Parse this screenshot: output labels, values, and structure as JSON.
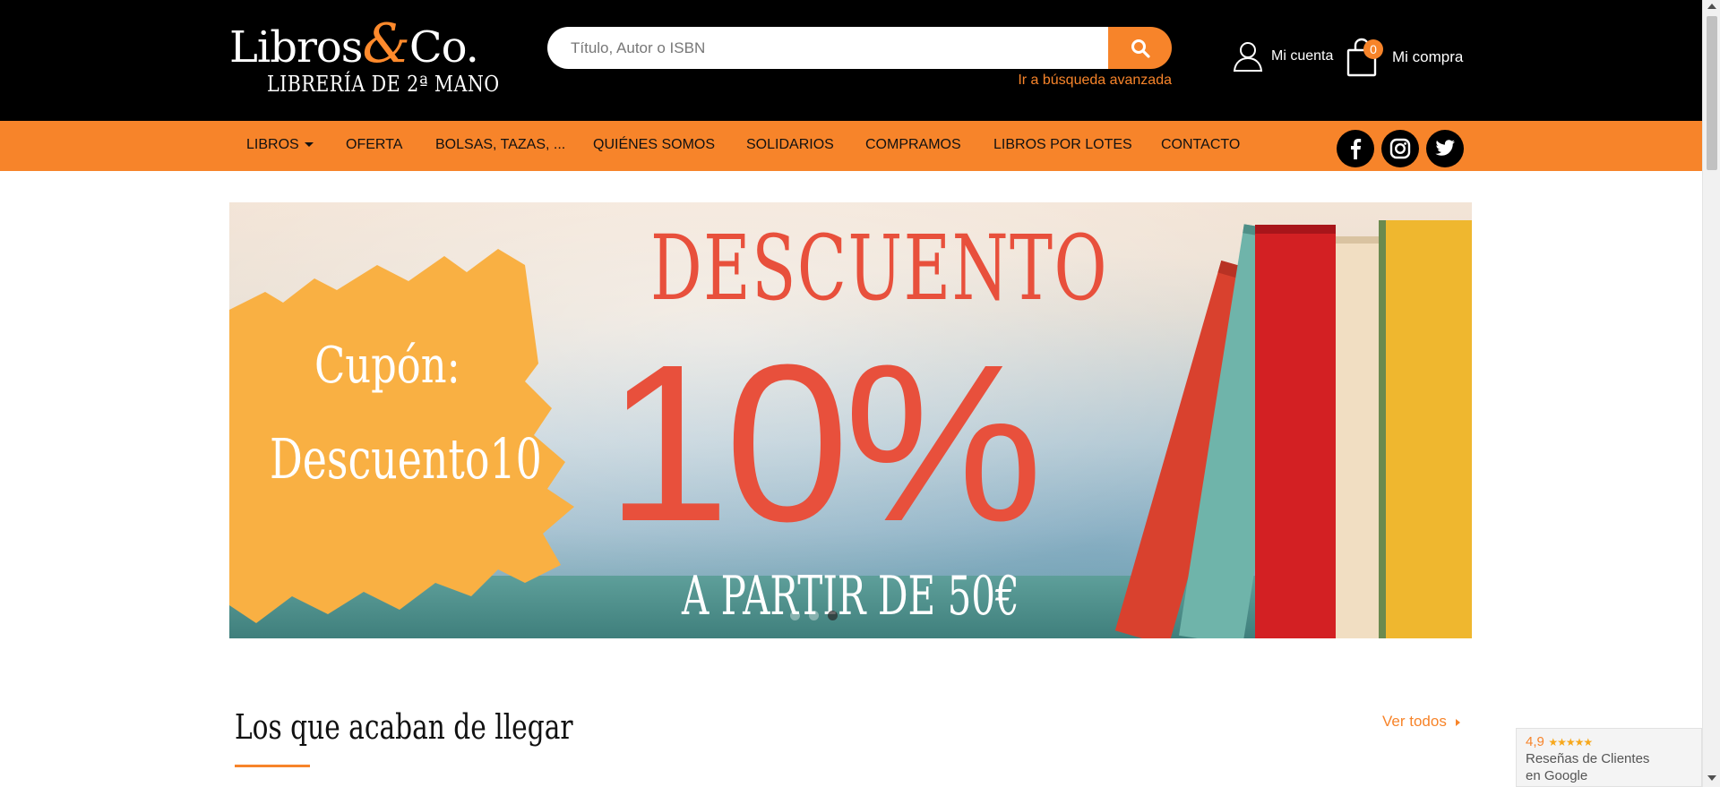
{
  "brand": {
    "name_part1": "Libros",
    "name_amp": "&",
    "name_part2": "Co.",
    "tagline": "Librería de 2ª mano"
  },
  "search": {
    "placeholder": "Título, Autor o ISBN",
    "value": "",
    "button_icon": "search-icon",
    "advanced_link": "Ir a búsqueda avanzada"
  },
  "account": {
    "icon": "user-icon",
    "label": "Mi cuenta"
  },
  "cart": {
    "icon": "shopping-bag-icon",
    "count": "0",
    "label": "Mi compra"
  },
  "nav": {
    "items": [
      {
        "label": "LIBROS",
        "has_dropdown": true
      },
      {
        "label": "OFERTA"
      },
      {
        "label": "BOLSAS, TAZAS, ..."
      },
      {
        "label": "QUIÉNES SOMOS"
      },
      {
        "label": "SOLIDARIOS"
      },
      {
        "label": "COMPRAMOS"
      },
      {
        "label": "LIBROS POR LOTES"
      },
      {
        "label": "CONTACTO"
      }
    ],
    "social": [
      "facebook-icon",
      "instagram-icon",
      "twitter-icon"
    ]
  },
  "banner": {
    "cupon_line1": "Cupón:",
    "cupon_line2": "Descuento10",
    "title": "DESCUENTO",
    "percent": "10%",
    "subtitle": "A PARTIR DE 50€",
    "slide_count": 3,
    "active_slide": 3
  },
  "section": {
    "title": "Los que acaban de llegar",
    "link": "Ver todos"
  },
  "reviews": {
    "rating": "4,9",
    "stars": "★★★★★",
    "line1": "Reseñas de Clientes",
    "line2": "en Google"
  },
  "colors": {
    "accent": "#f7842a",
    "header_bg": "#000000",
    "banner_text": "#e8503c"
  }
}
